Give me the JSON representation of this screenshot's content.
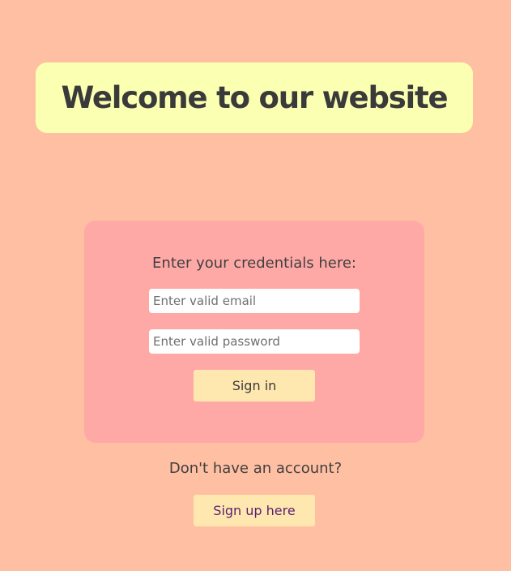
{
  "header": {
    "title": "Welcome to our website"
  },
  "login": {
    "prompt": "Enter your credentials here:",
    "email_placeholder": "Enter valid email",
    "email_value": "",
    "password_placeholder": "Enter valid password",
    "password_value": "",
    "signin_label": "Sign in"
  },
  "signup": {
    "question": "Don't have an account?",
    "button_label": "Sign up here"
  },
  "colors": {
    "background": "#ffbfa3",
    "header_card": "#fbffb1",
    "login_card": "#ffa9a7",
    "button": "#ffe8af",
    "signup_text": "#5a1f70"
  }
}
